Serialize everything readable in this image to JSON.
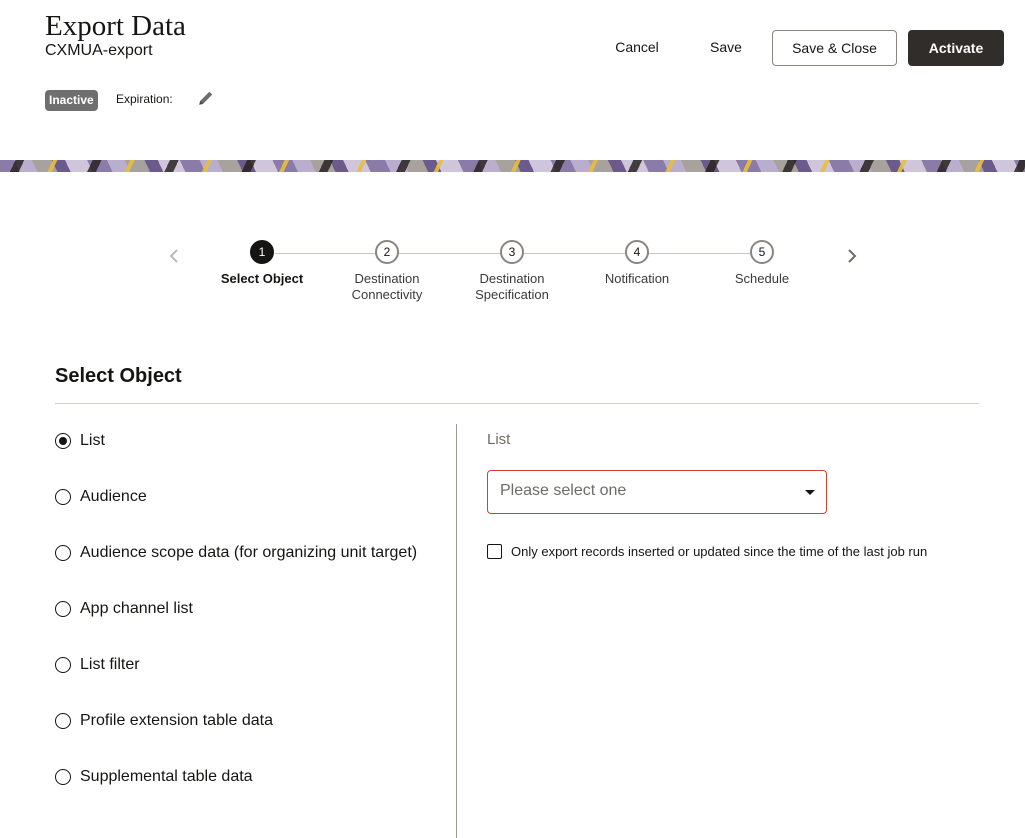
{
  "header": {
    "title": "Export Data",
    "subtitle": "CXMUA-export",
    "status": "Inactive",
    "expiration_label": "Expiration:",
    "actions": {
      "cancel": "Cancel",
      "save": "Save",
      "save_close": "Save & Close",
      "activate": "Activate"
    }
  },
  "train": {
    "steps": [
      {
        "number": "1",
        "line1": "Select Object",
        "line2": ""
      },
      {
        "number": "2",
        "line1": "Destination",
        "line2": "Connectivity"
      },
      {
        "number": "3",
        "line1": "Destination",
        "line2": "Specification"
      },
      {
        "number": "4",
        "line1": "Notification",
        "line2": ""
      },
      {
        "number": "5",
        "line1": "Schedule",
        "line2": ""
      }
    ],
    "active_index": 0
  },
  "section": {
    "title": "Select Object",
    "options": [
      {
        "label": "List",
        "selected": true
      },
      {
        "label": "Audience",
        "selected": false
      },
      {
        "label": "Audience scope data (for organizing unit target)",
        "selected": false
      },
      {
        "label": "App channel list",
        "selected": false
      },
      {
        "label": "List filter",
        "selected": false
      },
      {
        "label": "Profile extension table data",
        "selected": false
      },
      {
        "label": "Supplemental table data",
        "selected": false
      }
    ]
  },
  "detail": {
    "field_label": "List",
    "select_placeholder": "Please select one",
    "checkbox_label": "Only export records inserted or updated since the time of the last job run",
    "checkbox_checked": false
  },
  "colors": {
    "primary_dark": "#312d2a",
    "badge_gray": "#6f6f6f",
    "error_border": "#c74634"
  }
}
